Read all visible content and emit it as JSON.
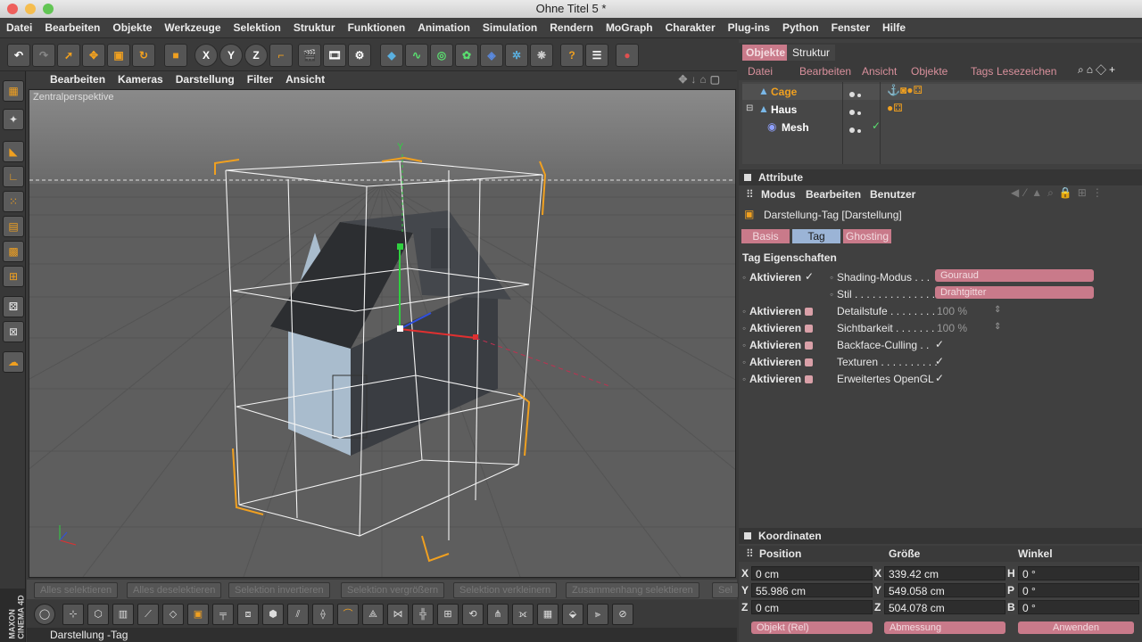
{
  "window": {
    "title": "Ohne Titel 5 *"
  },
  "menubar": [
    "Datei",
    "Bearbeiten",
    "Objekte",
    "Werkzeuge",
    "Selektion",
    "Struktur",
    "Funktionen",
    "Animation",
    "Simulation",
    "Rendern",
    "MoGraph",
    "Charakter",
    "Plug-ins",
    "Python",
    "Fenster",
    "Hilfe"
  ],
  "viewport": {
    "menu": [
      "Bearbeiten",
      "Kameras",
      "Darstellung",
      "Filter",
      "Ansicht"
    ],
    "label": "Zentralperspektive",
    "axis_label": "Y"
  },
  "selection_bar": [
    "Alles selektieren",
    "Alles deselektieren",
    "Selektion invertieren",
    "Selektion vergrößern",
    "Selektion verkleinern",
    "Zusammenhang selektieren",
    "Sel"
  ],
  "statusbar": {
    "text": "Darstellung -Tag"
  },
  "brand": {
    "line1": "MAXON",
    "line2": "CINEMA 4D"
  },
  "objects_panel": {
    "tabs": [
      "Objekte",
      "Struktur"
    ],
    "menu": [
      "Datei",
      "Bearbeiten",
      "Ansicht",
      "Objekte",
      "Tags",
      "Lesezeichen"
    ],
    "items": [
      {
        "name": "Cage",
        "color": "#f0a020"
      },
      {
        "name": "Haus",
        "color": "#ffffff"
      },
      {
        "name": "Mesh",
        "color": "#ffffff"
      }
    ]
  },
  "attributes_panel": {
    "title": "Attribute",
    "menu": [
      "Modus",
      "Bearbeiten",
      "Benutzer"
    ],
    "tag_title": "Darstellung-Tag [Darstellung]",
    "tabs": [
      "Basis",
      "Tag",
      "Ghosting"
    ],
    "section": "Tag Eigenschaften",
    "aktivieren": "Aktivieren",
    "props": [
      {
        "label": "Shading-Modus . . .",
        "value": "Gouraud"
      },
      {
        "label": "Stil . . . . . . . . . . . . . . . .",
        "value": "Drahtgitter"
      },
      {
        "label": "Detailstufe . . . . . . . .",
        "value": "100 %"
      },
      {
        "label": "Sichtbarkeit . . . . . . .",
        "value": "100 %"
      },
      {
        "label": "Backface-Culling . .",
        "value": "✓"
      },
      {
        "label": "Texturen . . . . . . . . . .",
        "value": "✓"
      },
      {
        "label": "Erweitertes OpenGL",
        "value": "✓"
      }
    ]
  },
  "coords_panel": {
    "title": "Koordinaten",
    "headers": [
      "Position",
      "Größe",
      "Winkel"
    ],
    "rows": [
      {
        "a": "X",
        "pos": "0 cm",
        "b": "X",
        "size": "339.42 cm",
        "c": "H",
        "angle": "0 °"
      },
      {
        "a": "Y",
        "pos": "55.986 cm",
        "b": "Y",
        "size": "549.058 cm",
        "c": "P",
        "angle": "0 °"
      },
      {
        "a": "Z",
        "pos": "0 cm",
        "b": "Z",
        "size": "504.078 cm",
        "c": "B",
        "angle": "0 °"
      }
    ],
    "mode1": "Objekt (Rel)",
    "mode2": "Abmessung",
    "apply": "Anwenden"
  },
  "colors": {
    "accent": "#f0a020",
    "pink": "#c97a8a",
    "tab_active": "#9bb4d6"
  }
}
